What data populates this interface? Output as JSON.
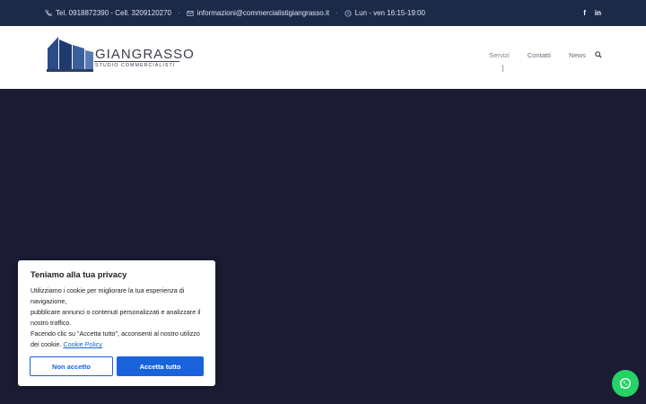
{
  "topbar": {
    "phone": "Tel. 0918872390 - Cell. 3209120270",
    "email": "informazioni@commercialistigiangrasso.it",
    "hours": "Lun - ven 16:15-19:00",
    "separator": "·",
    "social": {
      "facebook": "f",
      "linkedin": "in"
    }
  },
  "header": {
    "logo": {
      "title": "GIANGRASSO",
      "subtitle": "STUDIO COMMERCIALISTI"
    },
    "nav": [
      "Servizi",
      "Contatti",
      "News"
    ]
  },
  "cookie_banner": {
    "title": "Teniamo alla tua privacy",
    "lines": [
      "Utilizziamo i cookie per migliorare la tua esperienza di navigazione,",
      "pubblicare annunci o contenuti personalizzati e analizzare il nostro traffico.",
      "Facendo clic su \"Accetta tutto\", acconsenti al nostro utilizzo dei cookie."
    ],
    "policy_link": "Cookie Policy",
    "reject_label": "Non accetto",
    "accept_label": "Accetta tutto"
  },
  "colors": {
    "topbar": "#1c2a4a",
    "hero": "#1b1c34",
    "accent": "#1863dc",
    "whatsapp": "#25d366"
  }
}
